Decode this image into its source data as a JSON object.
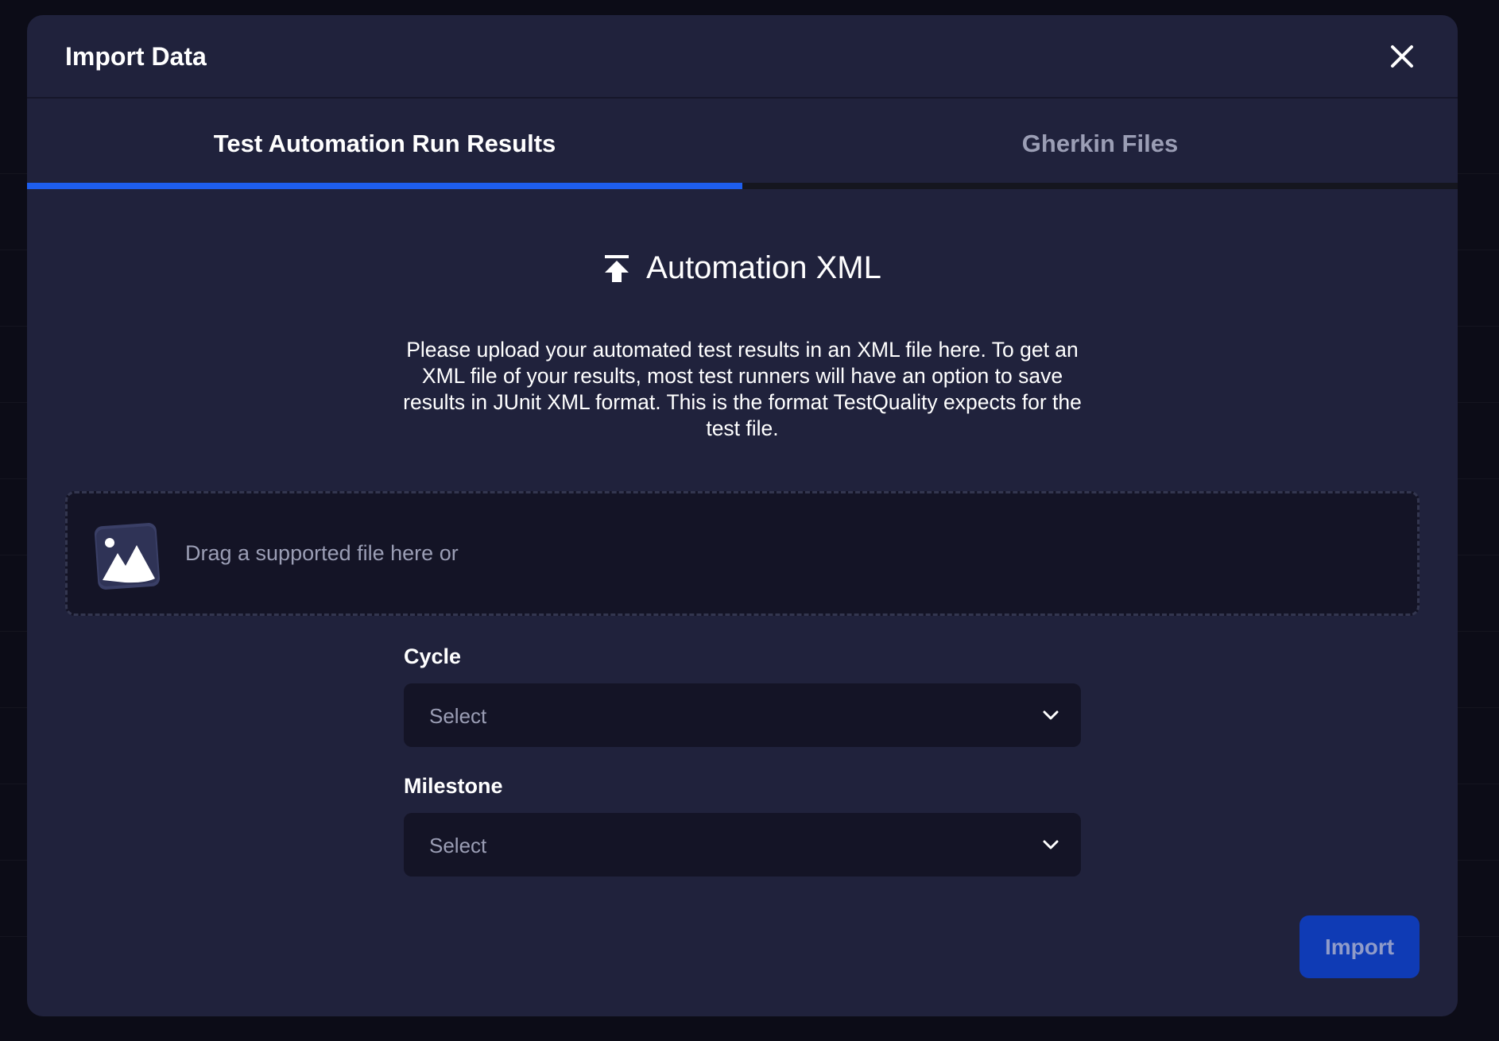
{
  "dialog": {
    "title": "Import Data",
    "close_icon": "close-icon"
  },
  "tabs": [
    {
      "label": "Test Automation Run Results",
      "active": true
    },
    {
      "label": "Gherkin Files",
      "active": false
    }
  ],
  "section": {
    "icon": "upload-icon",
    "title": "Automation XML",
    "description": "Please upload your automated test results in an XML file here. To get an XML file of your results, most test runners will have an option to save results in JUnit XML format. This is the format TestQuality expects for the test file."
  },
  "dropzone": {
    "icon": "image-icon",
    "text": "Drag a supported file here or"
  },
  "fields": {
    "cycle": {
      "label": "Cycle",
      "value": "Select"
    },
    "milestone": {
      "label": "Milestone",
      "value": "Select"
    }
  },
  "actions": {
    "import_label": "Import"
  },
  "colors": {
    "modal_bg": "#20223c",
    "accent": "#1e5eef",
    "button_bg": "#0f3bb5",
    "input_bg": "#141426"
  }
}
